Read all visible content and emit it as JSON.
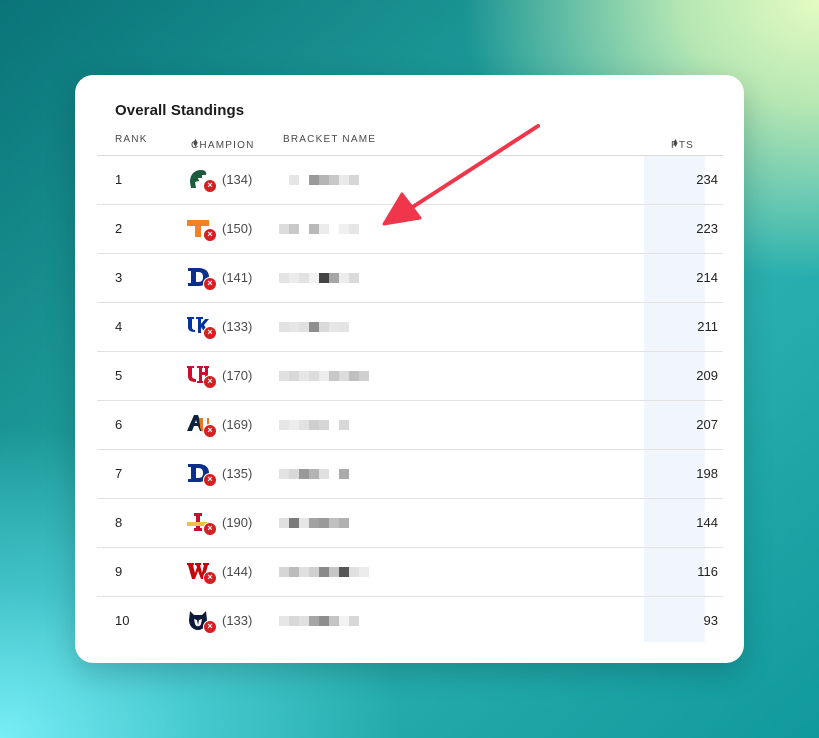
{
  "standings": {
    "title": "Overall Standings",
    "columns": {
      "rank": "RANK",
      "champion": "CHAMPION",
      "bracket": "BRACKET NAME",
      "pts": "PTS"
    },
    "rows": [
      {
        "rank": "1",
        "seed": "(134)",
        "pts": "234",
        "team_icon": "michigan-state-spartan-icon",
        "status_icon": "eliminated-x-icon"
      },
      {
        "rank": "2",
        "seed": "(150)",
        "pts": "223",
        "team_icon": "tennessee-t-icon",
        "status_icon": "eliminated-x-icon"
      },
      {
        "rank": "3",
        "seed": "(141)",
        "pts": "214",
        "team_icon": "duke-d-icon",
        "status_icon": "eliminated-x-icon"
      },
      {
        "rank": "4",
        "seed": "(133)",
        "pts": "211",
        "team_icon": "kentucky-uk-icon",
        "status_icon": "eliminated-x-icon"
      },
      {
        "rank": "5",
        "seed": "(170)",
        "pts": "209",
        "team_icon": "houston-uh-icon",
        "status_icon": "eliminated-x-icon"
      },
      {
        "rank": "6",
        "seed": "(169)",
        "pts": "207",
        "team_icon": "auburn-au-icon",
        "status_icon": "eliminated-x-icon"
      },
      {
        "rank": "7",
        "seed": "(135)",
        "pts": "198",
        "team_icon": "duke-d-icon",
        "status_icon": "eliminated-x-icon"
      },
      {
        "rank": "8",
        "seed": "(190)",
        "pts": "144",
        "team_icon": "iowa-state-i-icon",
        "status_icon": "eliminated-x-icon"
      },
      {
        "rank": "9",
        "seed": "(144)",
        "pts": "116",
        "team_icon": "wisconsin-w-icon",
        "status_icon": "eliminated-x-icon"
      },
      {
        "rank": "10",
        "seed": "(133)",
        "pts": "93",
        "team_icon": "uconn-husky-icon",
        "status_icon": "eliminated-x-icon"
      }
    ]
  },
  "annotation": {
    "arrow_icon": "red-arrow-icon",
    "arrow_color": "#f0364a"
  },
  "colors": {
    "eliminated_badge": "#d42020",
    "pts_column_bg": "#f1f6fd"
  }
}
